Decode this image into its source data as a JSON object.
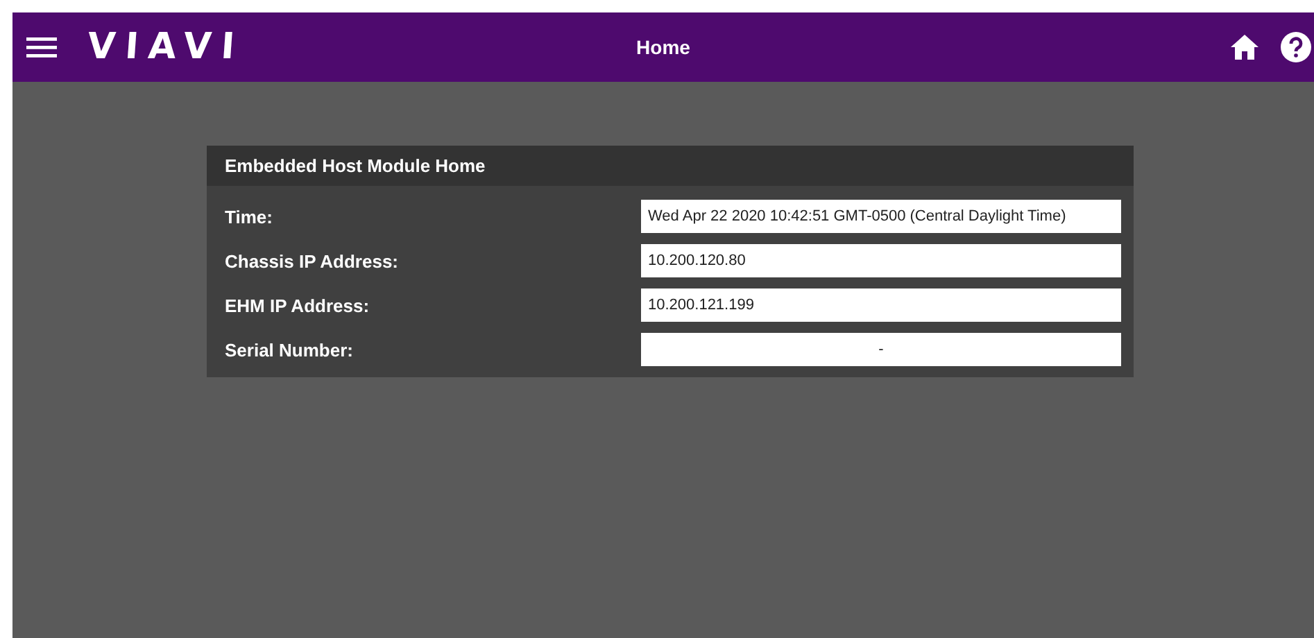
{
  "header": {
    "logo": "VIAVI",
    "title": "Home"
  },
  "panel": {
    "title": "Embedded Host Module Home",
    "rows": [
      {
        "label": "Time:",
        "value": "Wed Apr 22 2020 10:42:51 GMT-0500 (Central Daylight Time)",
        "kind": "value"
      },
      {
        "label": "Chassis IP Address:",
        "value": "10.200.120.80",
        "kind": "value"
      },
      {
        "label": "EHM IP Address:",
        "value": "10.200.121.199",
        "kind": "value"
      },
      {
        "label": "Serial Number:",
        "value": "-",
        "kind": "blank"
      }
    ]
  }
}
